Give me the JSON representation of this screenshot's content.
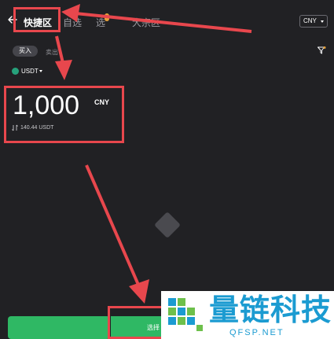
{
  "header": {
    "back_icon": "arrow-left-icon",
    "tabs": [
      {
        "label": "快捷区",
        "active": true
      },
      {
        "label": "自选",
        "active": false
      },
      {
        "label": "选",
        "active": false
      },
      {
        "label": "大宗区",
        "active": false
      }
    ],
    "tab_badge": "",
    "currency": "CNY"
  },
  "trade": {
    "buy_label": "买入",
    "sell_label": "卖出",
    "filter_icon": "filter-icon"
  },
  "coin": {
    "symbol": "USDT",
    "icon": "tether-icon",
    "color": "#26a17b"
  },
  "amount": {
    "value": "1,000",
    "unit": "CNY",
    "converted": "140.44 USDT",
    "swap_icon": "swap-icon"
  },
  "actions": {
    "select_label": "选择"
  },
  "watermark": {
    "title": "量链科技",
    "subtitle": "QFSP.NET"
  },
  "colors": {
    "background": "#212124",
    "accent_green": "#2fb864",
    "annotation_red": "#e8474d",
    "watermark_blue": "#1b9bd1"
  }
}
